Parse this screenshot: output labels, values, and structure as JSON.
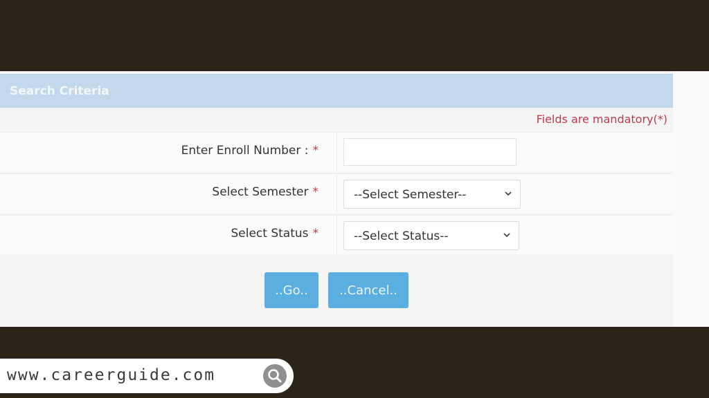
{
  "form": {
    "title": "Search Criteria",
    "mandatory_note": "Fields are mandatory(*)",
    "fields": [
      {
        "label": "Enter Enroll Number :",
        "required_mark": "*",
        "value": "",
        "placeholder": ""
      },
      {
        "label": "Select Semester",
        "required_mark": "*",
        "selected": "--Select Semester--"
      },
      {
        "label": "Select Status",
        "required_mark": "*",
        "selected": "--Select Status--"
      }
    ],
    "buttons": {
      "go": "..Go..",
      "cancel": "..Cancel.."
    }
  },
  "watermark": {
    "text": "www.careerguide.com",
    "icon": "search-icon"
  },
  "colors": {
    "background": "#2b2418",
    "header": "#c3d9eb",
    "button": "#5aaee0",
    "required": "#c0394a"
  }
}
